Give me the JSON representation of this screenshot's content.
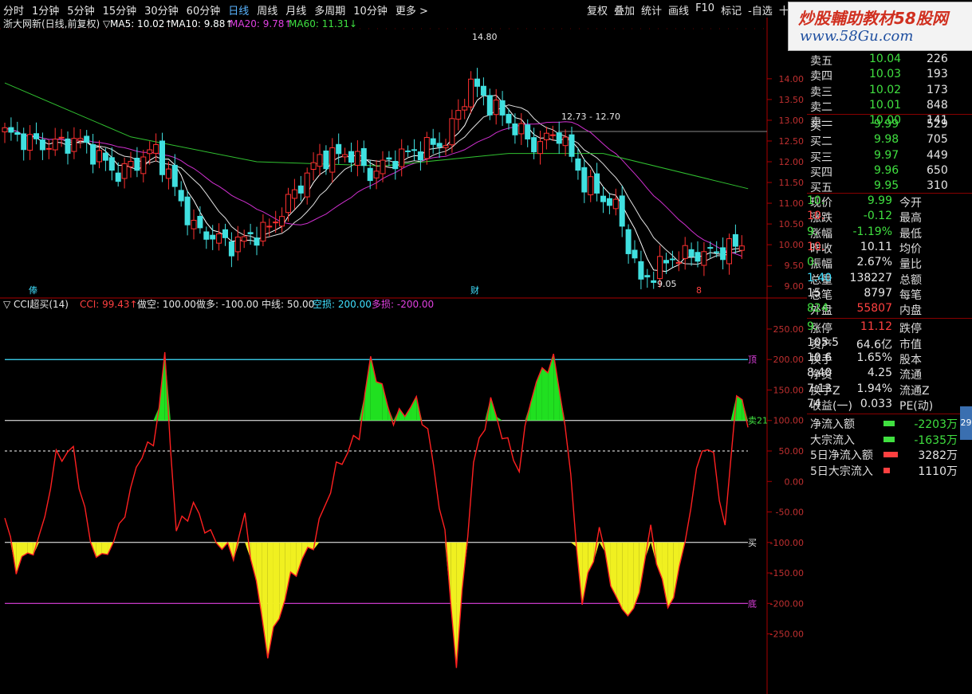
{
  "menu": {
    "left": [
      "分时",
      "1分钟",
      "5分钟",
      "15分钟",
      "30分钟",
      "60分钟",
      "日线",
      "周线",
      "月线",
      "多周期",
      "10分钟",
      "更多 >"
    ],
    "active": "日线",
    "right": [
      "复权",
      "叠加",
      "统计",
      "画线",
      "F10",
      "标记",
      "-自选",
      "十档"
    ]
  },
  "watermark": {
    "line1": "炒股輔助教材58股网",
    "line2": "www.58Gu.com"
  },
  "main_chart": {
    "title": "浙大网新(日线,前复权)",
    "ma": [
      {
        "label": "MA5: 10.02↑",
        "color": "#ffffff"
      },
      {
        "label": "MA10: 9.88↑",
        "color": "#ffffff"
      },
      {
        "label": "MA20: 9.78↑",
        "color": "#e040e0"
      },
      {
        "label": "MA60: 11.31↓",
        "color": "#40e040"
      }
    ],
    "y_ticks": [
      "14.00",
      "13.50",
      "13.00",
      "12.50",
      "12.00",
      "11.50",
      "11.00",
      "10.50",
      "10.00",
      "9.50",
      "9.00"
    ],
    "annotations": {
      "high": "14.80",
      "range": "12.73 - 12.70",
      "low": "9.05"
    },
    "markers": [
      "俸",
      "财",
      "8"
    ]
  },
  "indicator": {
    "title": "▽ CCI超买(14)",
    "labels": [
      {
        "text": "CCI: 99.43↑",
        "color": "#ff4040"
      },
      {
        "text": "做空: 100.00",
        "color": "#e6e6e6"
      },
      {
        "text": "做多: -100.00",
        "color": "#e6e6e6"
      },
      {
        "text": "中线: 50.00",
        "color": "#e6e6e6"
      },
      {
        "text": "空损: 200.00",
        "color": "#40e0ff"
      },
      {
        "text": "多损: -200.00",
        "color": "#e040e0"
      }
    ],
    "y_ticks": [
      "250.00",
      "200.00",
      "150.00",
      "100.00",
      "50.00",
      "0.00",
      "-50.00",
      "-100.00",
      "-150.00",
      "-200.00",
      "-250.00"
    ],
    "side_labels": {
      "top": "顶",
      "sell": "卖21",
      "buy": "买",
      "bottom": "底"
    }
  },
  "order_book": {
    "asks": [
      {
        "label": "卖五",
        "price": "10.04",
        "vol": "226"
      },
      {
        "label": "卖四",
        "price": "10.03",
        "vol": "193"
      },
      {
        "label": "卖三",
        "price": "10.02",
        "vol": "173"
      },
      {
        "label": "卖二",
        "price": "10.01",
        "vol": "848"
      },
      {
        "label": "卖一",
        "price": "10.00",
        "vol": "141"
      }
    ],
    "bids": [
      {
        "label": "买一",
        "price": "9.99",
        "vol": "529"
      },
      {
        "label": "买二",
        "price": "9.98",
        "vol": "705"
      },
      {
        "label": "买三",
        "price": "9.97",
        "vol": "449"
      },
      {
        "label": "买四",
        "price": "9.96",
        "vol": "650"
      },
      {
        "label": "买五",
        "price": "9.95",
        "vol": "310"
      }
    ]
  },
  "stats": [
    [
      {
        "t": "现价",
        "c": "#ddd"
      },
      {
        "t": "9.99",
        "c": "#40e040"
      },
      {
        "t": "今开",
        "c": "#ddd"
      },
      {
        "t": "10.",
        "c": "#40e040"
      }
    ],
    [
      {
        "t": "涨跌",
        "c": "#ddd"
      },
      {
        "t": "-0.12",
        "c": "#40e040"
      },
      {
        "t": "最高",
        "c": "#ddd"
      },
      {
        "t": "10.",
        "c": "#ff4040"
      }
    ],
    [
      {
        "t": "涨幅",
        "c": "#ddd"
      },
      {
        "t": "-1.19%",
        "c": "#40e040"
      },
      {
        "t": "最低",
        "c": "#ddd"
      },
      {
        "t": "9.",
        "c": "#40e040"
      }
    ],
    [
      {
        "t": "昨收",
        "c": "#ddd"
      },
      {
        "t": "10.11",
        "c": "#e6e6e6"
      },
      {
        "t": "均价",
        "c": "#ddd"
      },
      {
        "t": "10.",
        "c": "#ff4040"
      }
    ],
    [
      {
        "t": "振幅",
        "c": "#ddd"
      },
      {
        "t": "2.67%",
        "c": "#e6e6e6"
      },
      {
        "t": "量比",
        "c": "#ddd"
      },
      {
        "t": "0.",
        "c": "#40e040"
      }
    ],
    [
      {
        "t": "总量",
        "c": "#ddd"
      },
      {
        "t": "138227",
        "c": "#e6e6e6"
      },
      {
        "t": "总额",
        "c": "#ddd"
      },
      {
        "t": "1.40",
        "c": "#40e0ff"
      }
    ],
    [
      {
        "t": "总笔",
        "c": "#ddd"
      },
      {
        "t": "8797",
        "c": "#e6e6e6"
      },
      {
        "t": "每笔",
        "c": "#ddd"
      },
      {
        "t": "15",
        "c": "#e6e6e6"
      }
    ],
    [
      {
        "t": "外盘",
        "c": "#ddd"
      },
      {
        "t": "55807",
        "c": "#ff4040"
      },
      {
        "t": "内盘",
        "c": "#ddd"
      },
      {
        "t": "824",
        "c": "#40e040"
      }
    ],
    [
      {
        "t": "涨停",
        "c": "#ddd"
      },
      {
        "t": "11.12",
        "c": "#ff4040"
      },
      {
        "t": "跌停",
        "c": "#ddd"
      },
      {
        "t": "9.",
        "c": "#40e040"
      }
    ],
    [
      {
        "t": "资产",
        "c": "#ddd"
      },
      {
        "t": "64.6亿",
        "c": "#e6e6e6"
      },
      {
        "t": "市值",
        "c": "#ddd"
      },
      {
        "t": "105.5",
        "c": "#e6e6e6"
      }
    ],
    [
      {
        "t": "换手",
        "c": "#ddd"
      },
      {
        "t": "1.65%",
        "c": "#e6e6e6"
      },
      {
        "t": "股本",
        "c": "#ddd"
      },
      {
        "t": "10.6",
        "c": "#e6e6e6"
      }
    ],
    [
      {
        "t": "净资",
        "c": "#ddd"
      },
      {
        "t": "4.25",
        "c": "#e6e6e6"
      },
      {
        "t": "流通",
        "c": "#ddd"
      },
      {
        "t": "8.40",
        "c": "#e6e6e6"
      }
    ],
    [
      {
        "t": "换手Z",
        "c": "#ddd"
      },
      {
        "t": "1.94%",
        "c": "#e6e6e6"
      },
      {
        "t": "流通Z",
        "c": "#ddd"
      },
      {
        "t": "7.13",
        "c": "#e6e6e6"
      }
    ],
    [
      {
        "t": "收益(一)",
        "c": "#ddd"
      },
      {
        "t": "0.033",
        "c": "#e6e6e6"
      },
      {
        "t": "PE(动)",
        "c": "#ddd"
      },
      {
        "t": "74",
        "c": "#e6e6e6"
      }
    ]
  ],
  "flows": [
    {
      "label": "净流入额",
      "value": "-2203万",
      "color": "#40e040"
    },
    {
      "label": "大宗流入",
      "value": "-1635万",
      "color": "#40e040"
    },
    {
      "label": "5日净流入额",
      "value": "3282万",
      "color": "#ff4040"
    },
    {
      "label": "5日大宗流入",
      "value": "1110万",
      "color": "#ff4040"
    }
  ],
  "mini_badge": "29"
}
